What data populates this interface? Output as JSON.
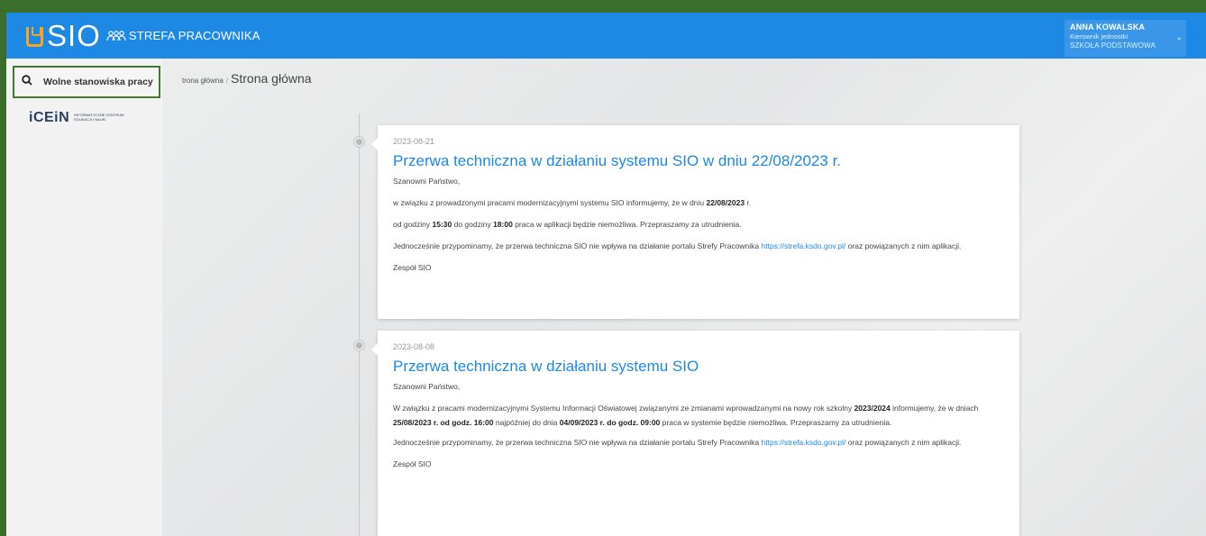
{
  "header": {
    "logo_text": "SIO",
    "subtitle": "STREFA PRACOWNIKA",
    "brand_color": "#1e88e5",
    "user": {
      "name": "ANNA KOWALSKA",
      "role": "Kierownik jednostki",
      "school": "SZKOŁA PODSTAWOWA"
    }
  },
  "sidebar": {
    "vacancy_label": "Wolne stanowiska pracy",
    "partner_logo": {
      "word": "iCEiN",
      "line1": "Informatyczne Centrum",
      "line2": "Edukacji i Nauki"
    }
  },
  "breadcrumb": {
    "link": "trona główna",
    "separator": "/",
    "current": "Strona główna"
  },
  "news": [
    {
      "date": "2023-08-21",
      "title": "Przerwa techniczna w działaniu systemu SIO w dniu 22/08/2023 r.",
      "greeting": "Szanowni Państwo,",
      "p1_a": "w związku z prowadzonymi pracami modernizacyjnymi systemu SIO informujemy, że w dniu ",
      "p1_b": "22/08/2023",
      "p1_c": " r.",
      "p2_a": "od godziny ",
      "p2_b": "15:30",
      "p2_c": " do godziny ",
      "p2_d": "18:00",
      "p2_e": " praca w aplikacji będzie niemożliwa. Przepraszamy za utrudnienia.",
      "p3_a": "Jednocześnie przypominamy, że przerwa techniczna SIO nie wpływa na działanie portalu Strefy Pracownika ",
      "p3_link": "https://strefa.ksdo.gov.pl/",
      "p3_b": " oraz powiązanych z nim aplikacji.",
      "signature": "Zespół SIO"
    },
    {
      "date": "2023-08-08",
      "title": "Przerwa techniczna w działaniu systemu SIO",
      "greeting": "Szanowni Państwo,",
      "p1_a": "W związku z pracami modernizacyjnymi Systemu Informacji Oświatowej związanymi ze zmianami wprowadzanymi na nowy rok szkolny ",
      "p1_b": "2023/2024",
      "p1_c": " informujemy, że w dniach ",
      "p1_d": "25/08/2023 r. od godz. 16:00",
      "p1_e": " najpóźniej do dnia ",
      "p1_f": "04/09/2023 r. do godz. 09:00",
      "p1_g": " praca w systemie będzie niemożliwa. Przepraszamy za utrudnienia.",
      "p3_a": "Jednocześnie przypominamy, że przerwa techniczna SIO nie wpływa na działanie portalu Strefy Pracownika ",
      "p3_link": "https://strefa.ksdo.gov.pl/",
      "p3_b": " oraz powiązanych z nim aplikacji.",
      "signature": "Zespół SIO"
    }
  ]
}
